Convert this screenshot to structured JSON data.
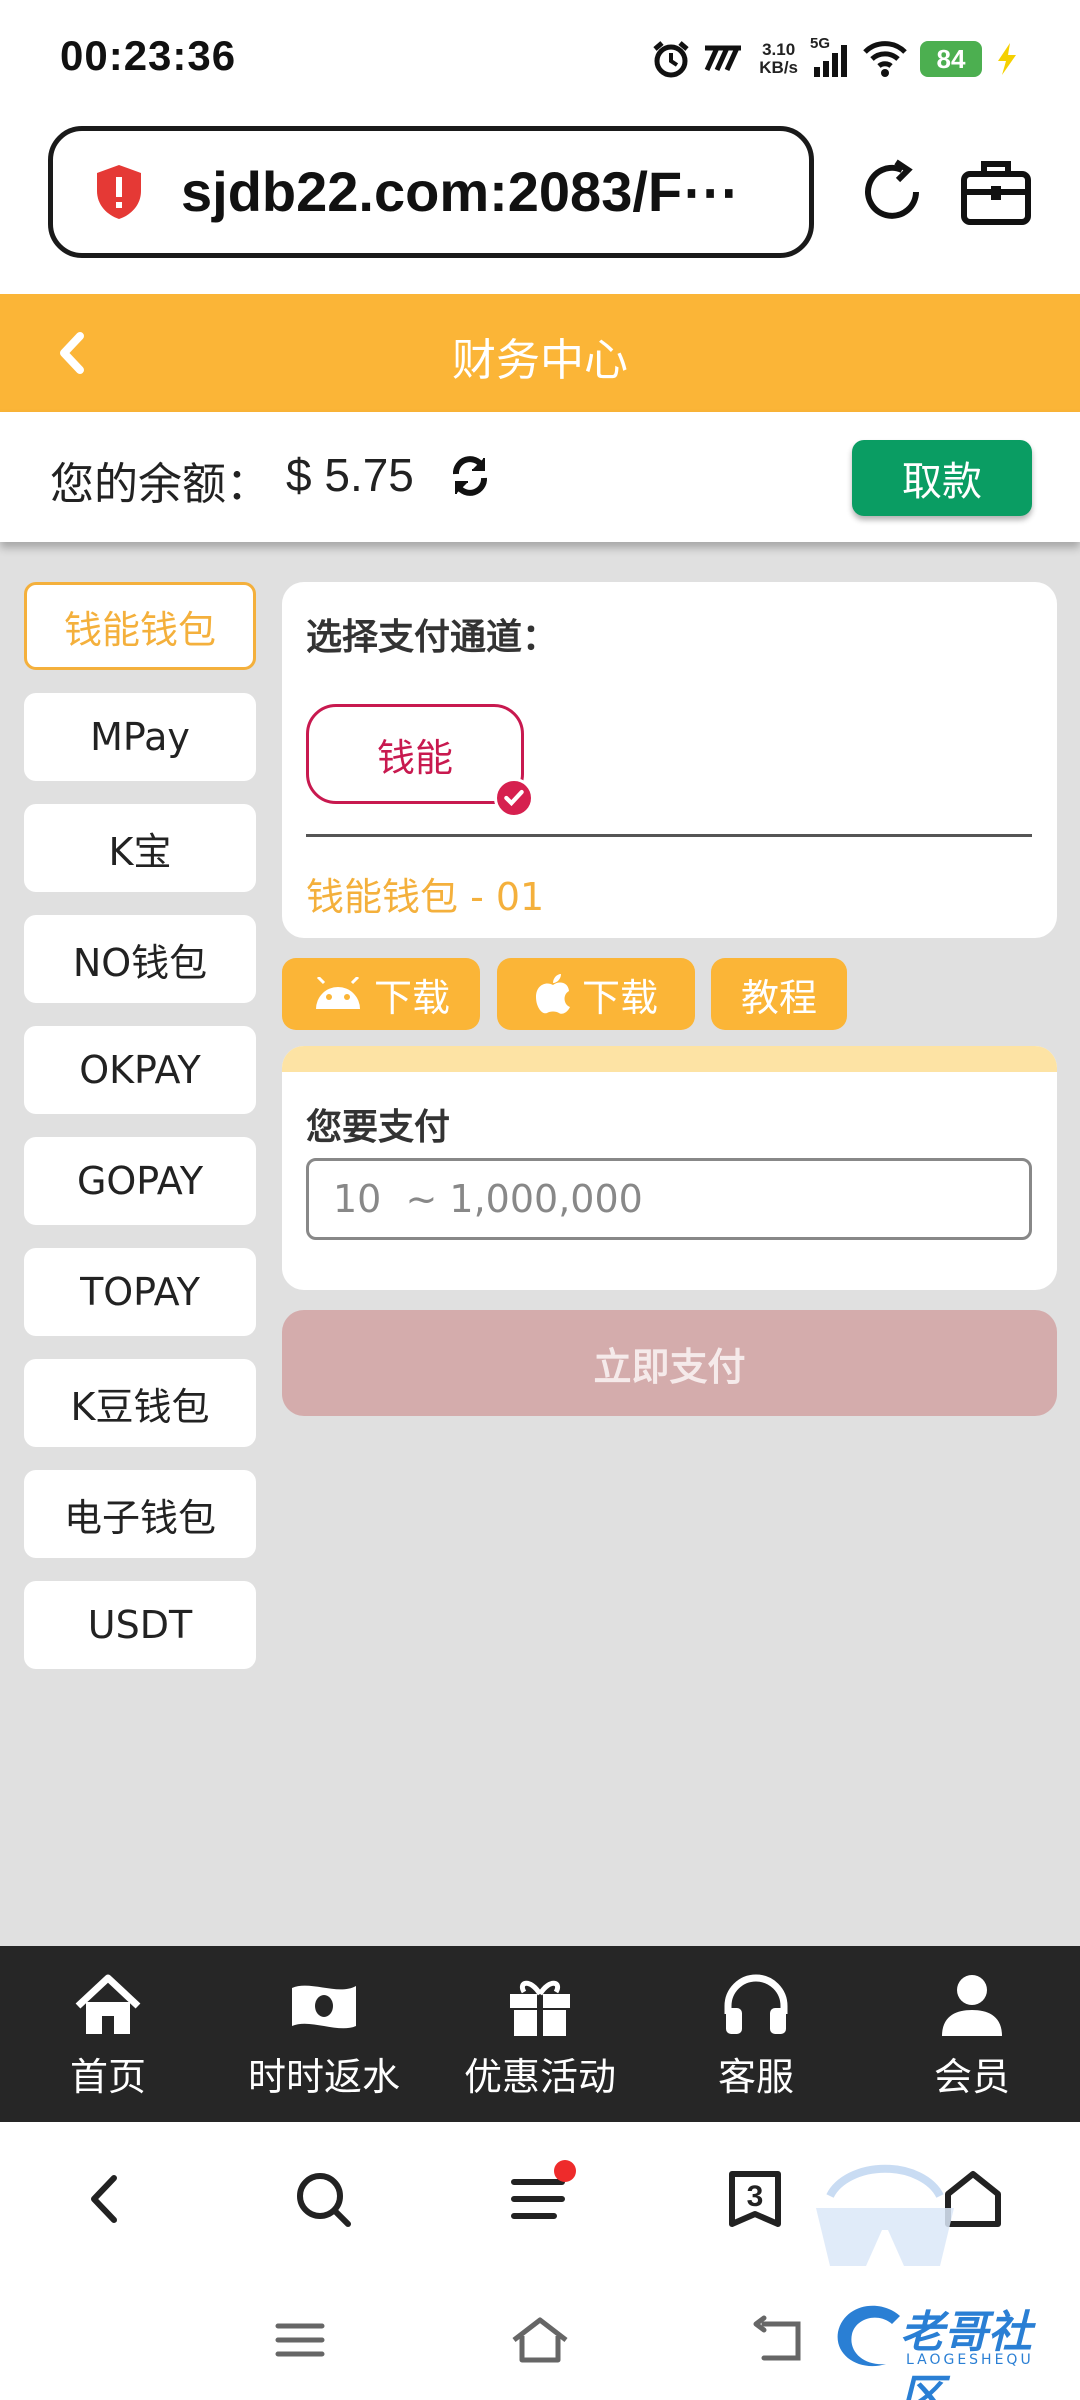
{
  "status_bar": {
    "time": "00:23:36",
    "net_speed_value": "3.10",
    "net_speed_unit": "KB/s",
    "network": "5G",
    "battery": "84"
  },
  "browser": {
    "url": "sjdb22.com:2083/F⋯",
    "tab_count": "3"
  },
  "header": {
    "title": "财务中心"
  },
  "balance": {
    "label": "您的余额：",
    "value": "$ 5.75",
    "withdraw_label": "取款"
  },
  "left_menu": {
    "items": [
      {
        "label": "钱能钱包",
        "active": true
      },
      {
        "label": "MPay"
      },
      {
        "label": "K宝"
      },
      {
        "label": "NO钱包"
      },
      {
        "label": "OKPAY"
      },
      {
        "label": "GOPAY"
      },
      {
        "label": "TOPAY"
      },
      {
        "label": "K豆钱包"
      },
      {
        "label": "电子钱包"
      },
      {
        "label": "USDT"
      }
    ]
  },
  "channel": {
    "title": "选择支付通道：",
    "option": "钱能",
    "subtitle": "钱能钱包 - 01"
  },
  "downloads": {
    "android_label": "下载",
    "ios_label": "下载",
    "tutorial_label": "教程"
  },
  "payment": {
    "label": "您要支付",
    "placeholder": "10  ~ 1,000,000",
    "submit_label": "立即支付"
  },
  "bottom_nav": {
    "items": [
      {
        "label": "首页",
        "icon": "home-icon"
      },
      {
        "label": "时时返水",
        "icon": "cash-icon"
      },
      {
        "label": "优惠活动",
        "icon": "gift-icon"
      },
      {
        "label": "客服",
        "icon": "headset-icon"
      },
      {
        "label": "会员",
        "icon": "user-icon"
      }
    ]
  },
  "watermark": {
    "text": "老哥社区",
    "sub": "LAOGESHEQU"
  },
  "colors": {
    "header": "#fbb537",
    "withdraw": "#0a9d63",
    "channel_accent": "#c8194f",
    "pay_disabled": "#d4acac",
    "bottom_nav": "#262626"
  }
}
